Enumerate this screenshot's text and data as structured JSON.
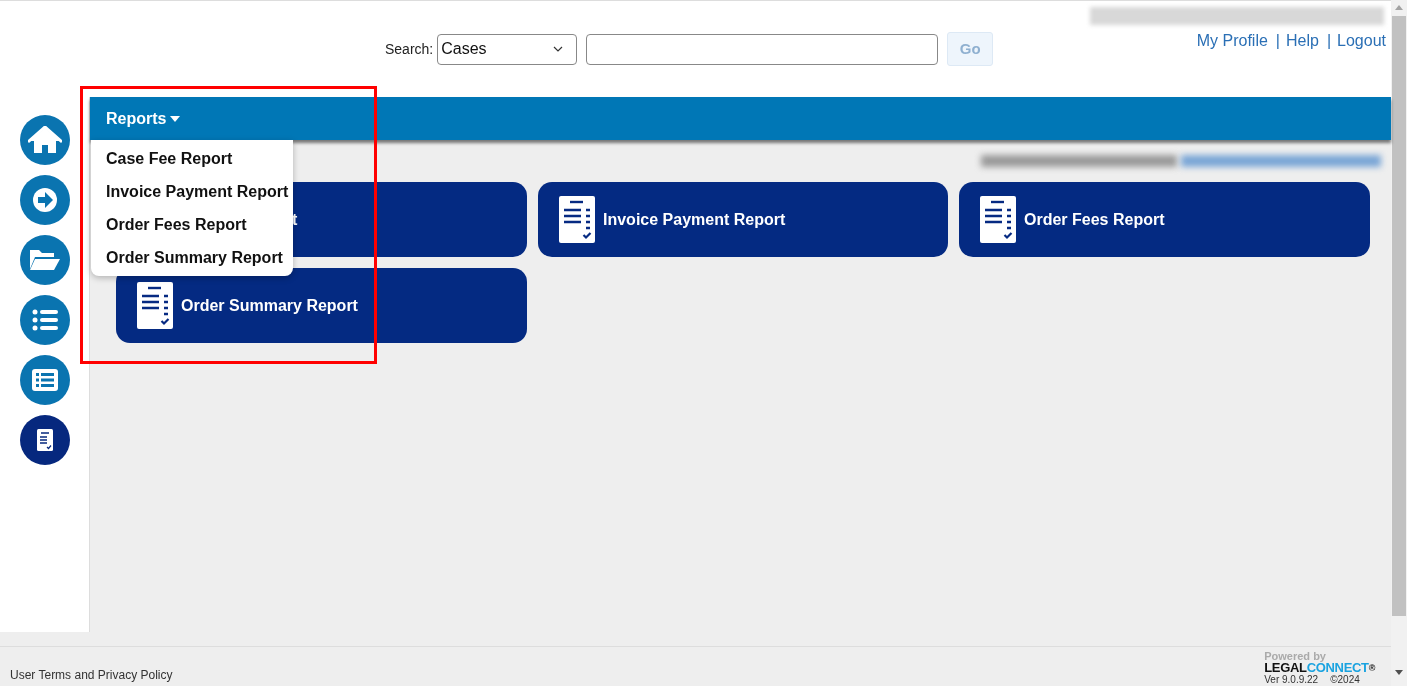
{
  "header": {
    "search_label": "Search:",
    "search_scope": "Cases",
    "go_button": "Go",
    "links": [
      "My Profile",
      "Help",
      "Logout"
    ],
    "link_separator": "|"
  },
  "sidebar": {
    "items": [
      {
        "kind": "home",
        "selected": false
      },
      {
        "kind": "arrow",
        "selected": false
      },
      {
        "kind": "folder",
        "selected": false
      },
      {
        "kind": "list",
        "selected": false
      },
      {
        "kind": "listbox",
        "selected": false
      },
      {
        "kind": "report",
        "selected": true
      }
    ]
  },
  "nav": {
    "menu_label": "Reports",
    "menu_items": [
      "Case Fee Report",
      "Invoice Payment Report",
      "Order Fees Report",
      "Order Summary Report"
    ]
  },
  "cards": [
    {
      "label": "t",
      "kind": "covered"
    },
    {
      "label": "Invoice Payment Report",
      "kind": "report"
    },
    {
      "label": "Order Fees Report",
      "kind": "report"
    },
    {
      "label": "Order Summary Report",
      "kind": "report"
    }
  ],
  "footer": {
    "terms_link": "User Terms and Privacy Policy",
    "powered_by": "Powered by",
    "brand_left": "LEGAL",
    "brand_right": "CONNECT",
    "brand_mark": "®",
    "version": "Ver 9.0.9.22",
    "copyright": "©2024"
  }
}
